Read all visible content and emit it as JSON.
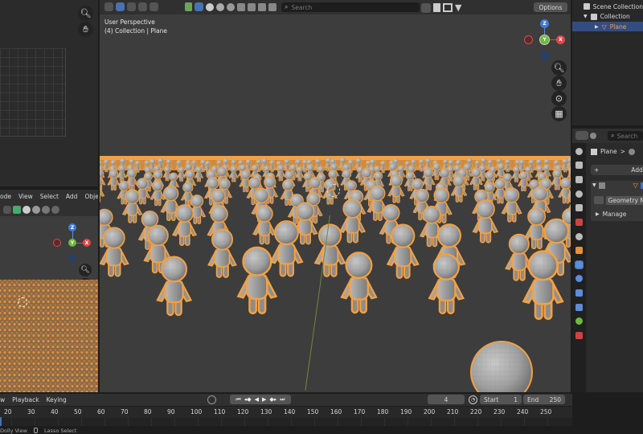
{
  "viewport": {
    "header": {
      "search_placeholder": "Search",
      "options_label": "Options"
    },
    "overlay": {
      "perspective": "User Perspective",
      "collection_path": "(4) Collection | Plane"
    }
  },
  "small_viewport": {
    "menu": [
      "ode",
      "View",
      "Select",
      "Add",
      "Obje"
    ]
  },
  "outliner": {
    "scene_collection": "Scene Collection",
    "collection": "Collection",
    "object": "Plane"
  },
  "properties": {
    "search_placeholder": "Search",
    "breadcrumb_object": "Plane",
    "breadcrumb_sep": ">",
    "add_modifier": "Add",
    "modifier_name": "Geometry N",
    "manage": "Manage"
  },
  "timeline": {
    "menu": [
      "w",
      "Playback",
      "Keying"
    ],
    "current_frame": "4",
    "start_label": "Start",
    "start_value": "1",
    "end_label": "End",
    "end_value": "250",
    "ruler": [
      "20",
      "30",
      "40",
      "50",
      "60",
      "70",
      "80",
      "90",
      "100",
      "110",
      "120",
      "130",
      "140",
      "150",
      "160",
      "170",
      "180",
      "190",
      "200",
      "210",
      "220",
      "230",
      "240",
      "250"
    ]
  },
  "status_bar": {
    "dolly": "Dolly View",
    "lasso": "Lasso Select"
  },
  "gizmo": {
    "z": "Z",
    "y": "Y",
    "x": "X"
  },
  "colors": {
    "accent_blue": "#4772b3",
    "selection_orange": "#f5a142",
    "viewport_bg": "#3d3d3d",
    "panel_bg": "#303030"
  },
  "icons": [
    "zoom-icon",
    "hand-pan-icon",
    "camera-icon",
    "grid-icon",
    "wrench-icon",
    "filter-icon"
  ]
}
